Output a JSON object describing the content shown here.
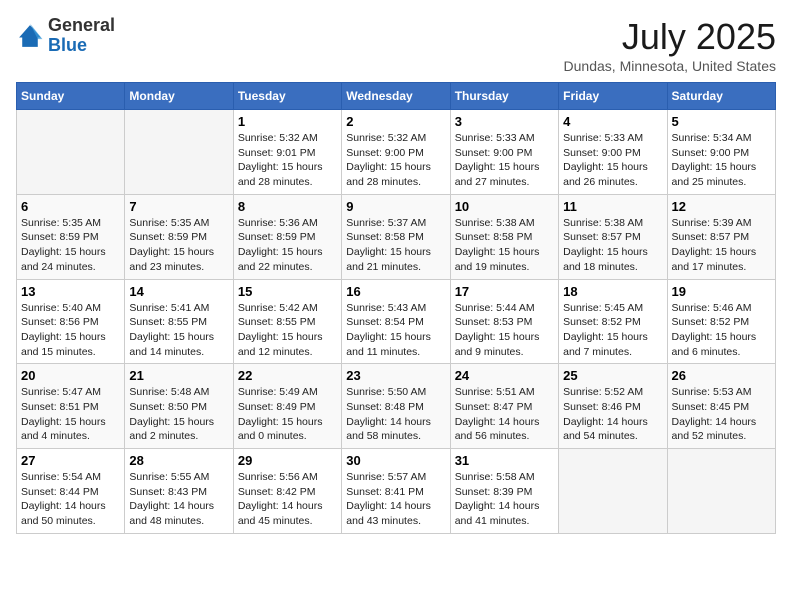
{
  "header": {
    "logo_general": "General",
    "logo_blue": "Blue",
    "title": "July 2025",
    "subtitle": "Dundas, Minnesota, United States"
  },
  "weekdays": [
    "Sunday",
    "Monday",
    "Tuesday",
    "Wednesday",
    "Thursday",
    "Friday",
    "Saturday"
  ],
  "weeks": [
    [
      null,
      null,
      {
        "day": "1",
        "sunrise": "5:32 AM",
        "sunset": "9:01 PM",
        "daylight": "15 hours and 28 minutes."
      },
      {
        "day": "2",
        "sunrise": "5:32 AM",
        "sunset": "9:00 PM",
        "daylight": "15 hours and 28 minutes."
      },
      {
        "day": "3",
        "sunrise": "5:33 AM",
        "sunset": "9:00 PM",
        "daylight": "15 hours and 27 minutes."
      },
      {
        "day": "4",
        "sunrise": "5:33 AM",
        "sunset": "9:00 PM",
        "daylight": "15 hours and 26 minutes."
      },
      {
        "day": "5",
        "sunrise": "5:34 AM",
        "sunset": "9:00 PM",
        "daylight": "15 hours and 25 minutes."
      }
    ],
    [
      {
        "day": "6",
        "sunrise": "5:35 AM",
        "sunset": "8:59 PM",
        "daylight": "15 hours and 24 minutes."
      },
      {
        "day": "7",
        "sunrise": "5:35 AM",
        "sunset": "8:59 PM",
        "daylight": "15 hours and 23 minutes."
      },
      {
        "day": "8",
        "sunrise": "5:36 AM",
        "sunset": "8:59 PM",
        "daylight": "15 hours and 22 minutes."
      },
      {
        "day": "9",
        "sunrise": "5:37 AM",
        "sunset": "8:58 PM",
        "daylight": "15 hours and 21 minutes."
      },
      {
        "day": "10",
        "sunrise": "5:38 AM",
        "sunset": "8:58 PM",
        "daylight": "15 hours and 19 minutes."
      },
      {
        "day": "11",
        "sunrise": "5:38 AM",
        "sunset": "8:57 PM",
        "daylight": "15 hours and 18 minutes."
      },
      {
        "day": "12",
        "sunrise": "5:39 AM",
        "sunset": "8:57 PM",
        "daylight": "15 hours and 17 minutes."
      }
    ],
    [
      {
        "day": "13",
        "sunrise": "5:40 AM",
        "sunset": "8:56 PM",
        "daylight": "15 hours and 15 minutes."
      },
      {
        "day": "14",
        "sunrise": "5:41 AM",
        "sunset": "8:55 PM",
        "daylight": "15 hours and 14 minutes."
      },
      {
        "day": "15",
        "sunrise": "5:42 AM",
        "sunset": "8:55 PM",
        "daylight": "15 hours and 12 minutes."
      },
      {
        "day": "16",
        "sunrise": "5:43 AM",
        "sunset": "8:54 PM",
        "daylight": "15 hours and 11 minutes."
      },
      {
        "day": "17",
        "sunrise": "5:44 AM",
        "sunset": "8:53 PM",
        "daylight": "15 hours and 9 minutes."
      },
      {
        "day": "18",
        "sunrise": "5:45 AM",
        "sunset": "8:52 PM",
        "daylight": "15 hours and 7 minutes."
      },
      {
        "day": "19",
        "sunrise": "5:46 AM",
        "sunset": "8:52 PM",
        "daylight": "15 hours and 6 minutes."
      }
    ],
    [
      {
        "day": "20",
        "sunrise": "5:47 AM",
        "sunset": "8:51 PM",
        "daylight": "15 hours and 4 minutes."
      },
      {
        "day": "21",
        "sunrise": "5:48 AM",
        "sunset": "8:50 PM",
        "daylight": "15 hours and 2 minutes."
      },
      {
        "day": "22",
        "sunrise": "5:49 AM",
        "sunset": "8:49 PM",
        "daylight": "15 hours and 0 minutes."
      },
      {
        "day": "23",
        "sunrise": "5:50 AM",
        "sunset": "8:48 PM",
        "daylight": "14 hours and 58 minutes."
      },
      {
        "day": "24",
        "sunrise": "5:51 AM",
        "sunset": "8:47 PM",
        "daylight": "14 hours and 56 minutes."
      },
      {
        "day": "25",
        "sunrise": "5:52 AM",
        "sunset": "8:46 PM",
        "daylight": "14 hours and 54 minutes."
      },
      {
        "day": "26",
        "sunrise": "5:53 AM",
        "sunset": "8:45 PM",
        "daylight": "14 hours and 52 minutes."
      }
    ],
    [
      {
        "day": "27",
        "sunrise": "5:54 AM",
        "sunset": "8:44 PM",
        "daylight": "14 hours and 50 minutes."
      },
      {
        "day": "28",
        "sunrise": "5:55 AM",
        "sunset": "8:43 PM",
        "daylight": "14 hours and 48 minutes."
      },
      {
        "day": "29",
        "sunrise": "5:56 AM",
        "sunset": "8:42 PM",
        "daylight": "14 hours and 45 minutes."
      },
      {
        "day": "30",
        "sunrise": "5:57 AM",
        "sunset": "8:41 PM",
        "daylight": "14 hours and 43 minutes."
      },
      {
        "day": "31",
        "sunrise": "5:58 AM",
        "sunset": "8:39 PM",
        "daylight": "14 hours and 41 minutes."
      },
      null,
      null
    ]
  ]
}
